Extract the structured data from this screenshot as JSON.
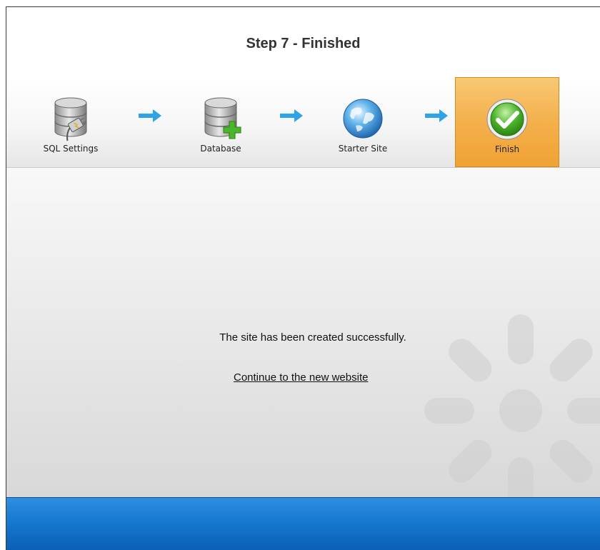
{
  "header": {
    "title": "Step 7 - Finished"
  },
  "steps": [
    {
      "label": "SQL Settings",
      "icon": "database-connection-icon",
      "active": false
    },
    {
      "label": "Database",
      "icon": "database-add-icon",
      "active": false
    },
    {
      "label": "Starter Site",
      "icon": "globe-icon",
      "active": false
    },
    {
      "label": "Finish",
      "icon": "checkmark-icon",
      "active": true
    }
  ],
  "content": {
    "message": "The site has been created successfully.",
    "link_label": "Continue to the new website"
  },
  "colors": {
    "active_step": "#f4b04c",
    "arrow": "#2ea3e8",
    "footer": "#1678cf",
    "check_green": "#4bb52c"
  }
}
